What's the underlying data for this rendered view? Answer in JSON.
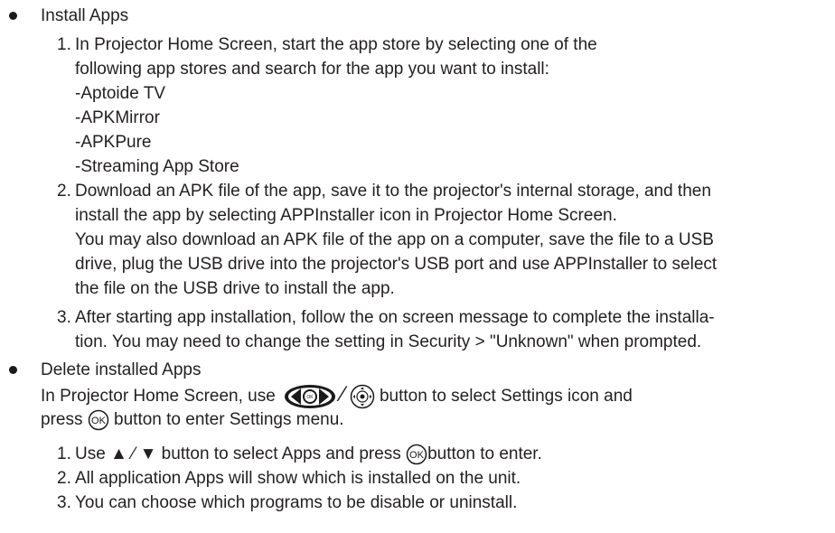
{
  "sections": {
    "install": {
      "heading": "Install Apps",
      "step1": {
        "num": "1.",
        "line1": "In Projector Home Screen, start the app store by selecting one of the",
        "line2": "following app stores and search for the app you want to install:",
        "stores": [
          "-Aptoide TV",
          "-APKMirror",
          "-APKPure",
          "-Streaming App Store"
        ]
      },
      "step2": {
        "num": "2.",
        "line1": "Download an APK file of the app, save it to the projector's internal storage, and then",
        "line2": "install the app by selecting APPInstaller icon in Projector Home Screen.",
        "line3": "You may also download an APK file of the app on a computer, save the file to a USB",
        "line4": "drive, plug the USB drive into the projector's USB port and use APPInstaller to select",
        "line5": "the file on the USB drive to install the app."
      },
      "step3": {
        "num": "3.",
        "line1": "After starting app installation, follow the on screen message to complete the installa-",
        "line2": "tion. You may need to change the setting in Security > \"Unknown\" when prompted."
      }
    },
    "delete": {
      "heading": "Delete installed  Apps",
      "intro": {
        "part1": "In Projector Home Screen, use",
        "part2": "button to select Settings icon and",
        "part3": "press",
        "part4": "button to enter Settings menu."
      },
      "step1": {
        "num": "1.",
        "part1": "Use ▲ ⁄ ▼ button to select Apps and press",
        "part2": "button to enter."
      },
      "step2": {
        "num": "2.",
        "text": "All application Apps will show which is installed on the unit."
      },
      "step3": {
        "num": "3.",
        "text": "You can choose which programs to be disable or uninstall."
      },
      "ok_label": "OK",
      "slash": "⁄"
    }
  },
  "icons": [
    "bullet-icon",
    "dpad-icon",
    "remote-dpad-icon",
    "ok-button-icon"
  ]
}
